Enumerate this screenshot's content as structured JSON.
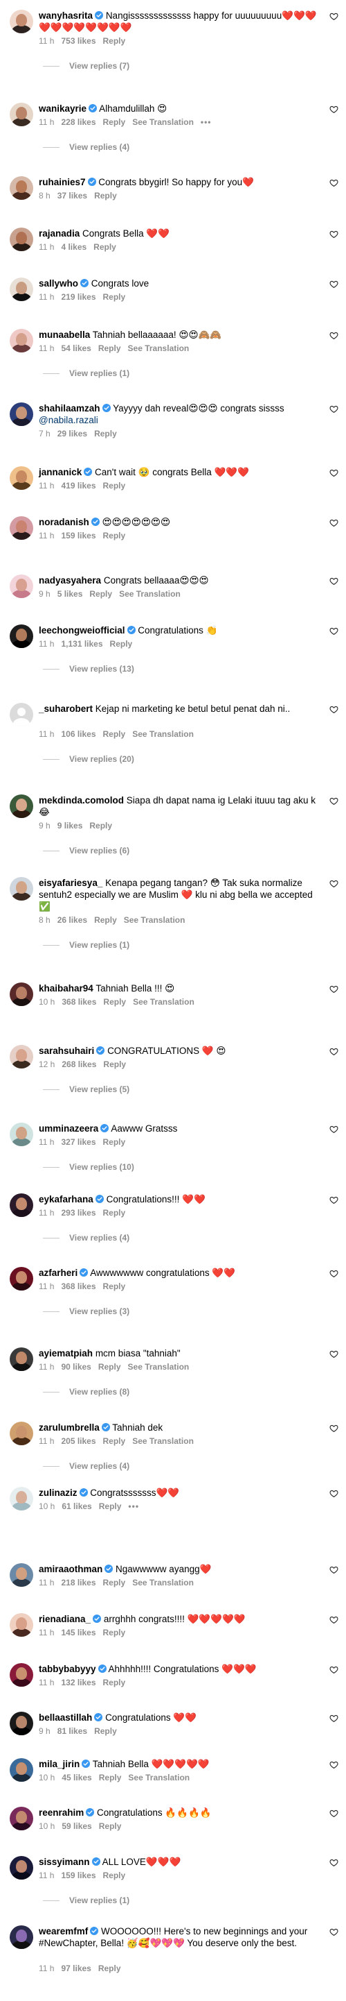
{
  "ui": {
    "view_replies_prefix": "View replies",
    "more_options": "•••"
  },
  "comments": [
    {
      "user": "wanyhasrita",
      "verified": true,
      "text": "Nangisssssssssssss happy for uuuuuuuuu❤️❤️❤️❤️❤️❤️❤️❤️❤️❤️❤️",
      "time": "11 h",
      "likes": "753 likes",
      "reply": "Reply",
      "translate": "",
      "more": false,
      "replies_count": "7"
    },
    {
      "user": "wanikayrie",
      "verified": true,
      "text": "Alhamdulillah 😍",
      "time": "11 h",
      "likes": "228 likes",
      "reply": "Reply",
      "translate": "See Translation",
      "more": true,
      "replies_count": "4"
    },
    {
      "user": "ruhainies7",
      "verified": true,
      "text": "Congrats bbygirl! So happy for you❤️",
      "time": "8 h",
      "likes": "37 likes",
      "reply": "Reply",
      "translate": "",
      "more": false,
      "replies_count": ""
    },
    {
      "user": "rajanadia",
      "verified": false,
      "text": "Congrats Bella ❤️❤️",
      "time": "11 h",
      "likes": "4 likes",
      "reply": "Reply",
      "translate": "",
      "more": false,
      "replies_count": ""
    },
    {
      "user": "sallywho",
      "verified": true,
      "text": "Congrats love",
      "time": "11 h",
      "likes": "219 likes",
      "reply": "Reply",
      "translate": "",
      "more": false,
      "replies_count": ""
    },
    {
      "user": "munaabella",
      "verified": false,
      "text": "Tahniah bellaaaaaa! 😍😍🙈🙈",
      "time": "11 h",
      "likes": "54 likes",
      "reply": "Reply",
      "translate": "See Translation",
      "more": false,
      "replies_count": "1"
    },
    {
      "user": "shahilaamzah",
      "verified": true,
      "text": "Yayyyy dah reveal😍😍😍 congrats sissss @nabila.razali",
      "time": "7 h",
      "likes": "29 likes",
      "reply": "Reply",
      "translate": "",
      "more": false,
      "replies_count": ""
    },
    {
      "user": "jannanick",
      "verified": true,
      "text": "Can't wait 🥹 congrats Bella ❤️❤️❤️",
      "time": "11 h",
      "likes": "419 likes",
      "reply": "Reply",
      "translate": "",
      "more": false,
      "replies_count": ""
    },
    {
      "user": "noradanish",
      "verified": true,
      "text": "😍😍😍😍😍😍😍",
      "time": "11 h",
      "likes": "159 likes",
      "reply": "Reply",
      "translate": "",
      "more": false,
      "replies_count": ""
    },
    {
      "user": "nadyasyahera",
      "verified": false,
      "text": "Congrats bellaaaa😍😍😍",
      "time": "9 h",
      "likes": "5 likes",
      "reply": "Reply",
      "translate": "See Translation",
      "more": false,
      "replies_count": ""
    },
    {
      "user": "leechongweiofficial",
      "verified": true,
      "text": "Congratulations 👏",
      "time": "11 h",
      "likes": "1,131 likes",
      "reply": "Reply",
      "translate": "",
      "more": false,
      "replies_count": "13"
    },
    {
      "user": "_suharobert",
      "verified": false,
      "text": "Kejap ni marketing ke betul betul penat dah ni..",
      "time": "11 h",
      "likes": "106 likes",
      "reply": "Reply",
      "translate": "See Translation",
      "more": false,
      "replies_count": "20"
    },
    {
      "user": "mekdinda.comolod",
      "verified": false,
      "text": "Siapa dh dapat nama ig Lelaki ituuu tag aku k 😂",
      "time": "9 h",
      "likes": "9 likes",
      "reply": "Reply",
      "translate": "",
      "more": false,
      "replies_count": "6"
    },
    {
      "user": "eisyafariesya_",
      "verified": false,
      "text": "Kenapa pegang tangan? 😳 Tak suka normalize sentuh2 especially we are Muslim ❤️ klu ni abg bella we accepted ✅",
      "time": "8 h",
      "likes": "26 likes",
      "reply": "Reply",
      "translate": "See Translation",
      "more": false,
      "replies_count": "1"
    },
    {
      "user": "khaibahar94",
      "verified": false,
      "text": "Tahniah Bella !!! 😍",
      "time": "10 h",
      "likes": "368 likes",
      "reply": "Reply",
      "translate": "See Translation",
      "more": false,
      "replies_count": ""
    },
    {
      "user": "sarahsuhairi",
      "verified": true,
      "text": "CONGRATULATIONS ❤️ 😍",
      "time": "12 h",
      "likes": "268 likes",
      "reply": "Reply",
      "translate": "",
      "more": false,
      "replies_count": "5"
    },
    {
      "user": "umminazeera",
      "verified": true,
      "text": "Aawww Gratsss",
      "time": "11 h",
      "likes": "327 likes",
      "reply": "Reply",
      "translate": "",
      "more": false,
      "replies_count": "10"
    },
    {
      "user": "eykafarhana",
      "verified": true,
      "text": "Congratulations!!! ❤️❤️",
      "time": "11 h",
      "likes": "293 likes",
      "reply": "Reply",
      "translate": "",
      "more": false,
      "replies_count": "4"
    },
    {
      "user": "azfarheri",
      "verified": true,
      "text": "Awwwwwww congratulations ❤️❤️",
      "time": "11 h",
      "likes": "368 likes",
      "reply": "Reply",
      "translate": "",
      "more": false,
      "replies_count": "3"
    },
    {
      "user": "ayiematpiah",
      "verified": false,
      "text": "mcm biasa \"tahniah\"",
      "time": "11 h",
      "likes": "90 likes",
      "reply": "Reply",
      "translate": "See Translation",
      "more": false,
      "replies_count": "8"
    },
    {
      "user": "zarulumbrella",
      "verified": true,
      "text": "Tahniah dek",
      "time": "11 h",
      "likes": "205 likes",
      "reply": "Reply",
      "translate": "See Translation",
      "more": false,
      "replies_count": "4"
    },
    {
      "user": "zulinaziz",
      "verified": true,
      "text": "Congratsssssss❤️❤️",
      "time": "10 h",
      "likes": "61 likes",
      "reply": "Reply",
      "translate": "",
      "more": true,
      "replies_count": ""
    },
    {
      "user": "amiraaothman",
      "verified": true,
      "text": "Ngawwwww ayangg❤️",
      "time": "11 h",
      "likes": "218 likes",
      "reply": "Reply",
      "translate": "See Translation",
      "more": false,
      "replies_count": ""
    },
    {
      "user": "rienadiana_",
      "verified": true,
      "text": "arrghhh congrats!!!! ❤️❤️❤️❤️❤️",
      "time": "11 h",
      "likes": "145 likes",
      "reply": "Reply",
      "translate": "",
      "more": false,
      "replies_count": ""
    },
    {
      "user": "tabbybabyyy",
      "verified": true,
      "text": "Ahhhhh!!!! Congratulations ❤️❤️❤️",
      "time": "11 h",
      "likes": "132 likes",
      "reply": "Reply",
      "translate": "",
      "more": false,
      "replies_count": ""
    },
    {
      "user": "bellaastillah",
      "verified": true,
      "text": "Congratulations ❤️❤️",
      "time": "9 h",
      "likes": "81 likes",
      "reply": "Reply",
      "translate": "",
      "more": false,
      "replies_count": ""
    },
    {
      "user": "mila_jirin",
      "verified": true,
      "text": "Tahniah Bella ❤️❤️❤️❤️❤️",
      "time": "10 h",
      "likes": "45 likes",
      "reply": "Reply",
      "translate": "See Translation",
      "more": false,
      "replies_count": ""
    },
    {
      "user": "reenrahim",
      "verified": true,
      "text": "Congratulations 🔥🔥🔥🔥",
      "time": "10 h",
      "likes": "59 likes",
      "reply": "Reply",
      "translate": "",
      "more": false,
      "replies_count": ""
    },
    {
      "user": "sissyimann",
      "verified": true,
      "text": "ALL LOVE❤️❤️❤️",
      "time": "11 h",
      "likes": "159 likes",
      "reply": "Reply",
      "translate": "",
      "more": false,
      "replies_count": "1"
    },
    {
      "user": "wearemfmf",
      "verified": true,
      "text": "WOOOOOO!!! Here's to new beginnings and your #NewChapter, Bella! 🥳🥰💖💖💖 You deserve only the best.",
      "time": "11 h",
      "likes": "97 likes",
      "reply": "Reply",
      "translate": "",
      "more": false,
      "replies_count": ""
    }
  ],
  "colors": {
    "verified": "#3897f0",
    "secondary": "#8e8e8e",
    "mention": "#00376b",
    "heart": "#262626"
  }
}
